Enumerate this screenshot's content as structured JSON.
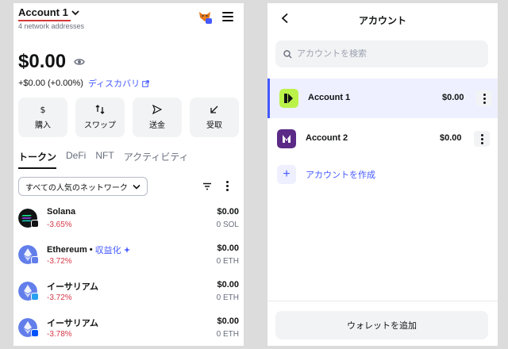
{
  "left": {
    "account_name": "Account 1",
    "network_addresses": "4 network addresses",
    "balance": "$0.00",
    "change": "+$0.00 (+0.00%)",
    "discover_label": "ディスカバリ",
    "actions": [
      {
        "label": "購入",
        "icon": "dollar-icon"
      },
      {
        "label": "スワップ",
        "icon": "swap-icon"
      },
      {
        "label": "送金",
        "icon": "send-icon"
      },
      {
        "label": "受取",
        "icon": "receive-icon"
      }
    ],
    "tabs": [
      "トークン",
      "DeFi",
      "NFT",
      "アクティビティ"
    ],
    "network_filter": "すべての人気のネットワーク",
    "tokens": [
      {
        "name": "Solana",
        "change": "-3.65%",
        "value": "$0.00",
        "amount": "0 SOL",
        "earn": ""
      },
      {
        "name": "Ethereum",
        "earn": "収益化",
        "change": "-3.72%",
        "value": "$0.00",
        "amount": "0 ETH"
      },
      {
        "name": "イーサリアム",
        "change": "-3.72%",
        "value": "$0.00",
        "amount": "0 ETH",
        "earn": ""
      },
      {
        "name": "イーサリアム",
        "change": "-3.78%",
        "value": "$0.00",
        "amount": "0 ETH",
        "earn": ""
      }
    ]
  },
  "right": {
    "title": "アカウント",
    "search_placeholder": "アカウントを検索",
    "accounts": [
      {
        "name": "Account 1",
        "balance": "$0.00"
      },
      {
        "name": "Account 2",
        "balance": "$0.00"
      }
    ],
    "create_label": "アカウントを作成",
    "add_wallet_label": "ウォレットを追加"
  },
  "colors": {
    "accent": "#4459ff",
    "negative": "#d73847",
    "underline": "#d23a3a"
  }
}
